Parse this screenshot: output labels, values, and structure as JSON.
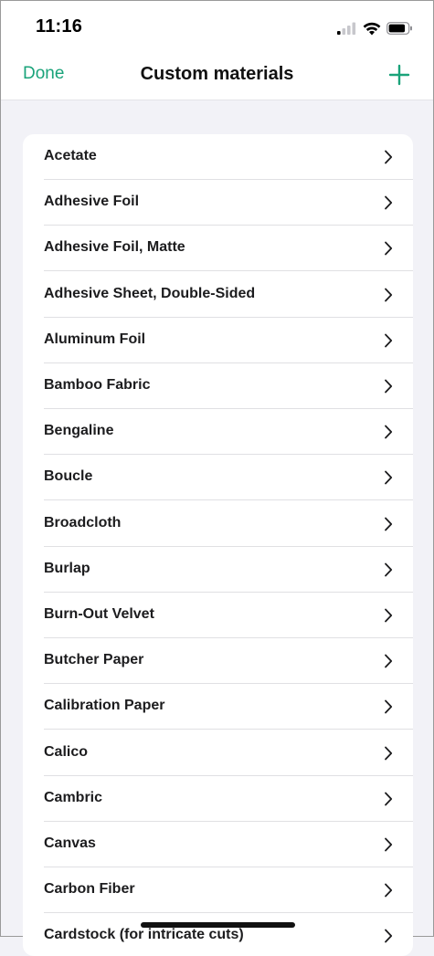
{
  "status_bar": {
    "time": "11:16"
  },
  "nav": {
    "done_label": "Done",
    "title": "Custom materials",
    "add_icon": "plus-icon"
  },
  "colors": {
    "accent": "#1aa37a",
    "background": "#f2f2f7",
    "card": "#ffffff"
  },
  "materials": [
    "Acetate",
    "Adhesive Foil",
    "Adhesive Foil, Matte",
    "Adhesive Sheet, Double-Sided",
    "Aluminum Foil",
    "Bamboo Fabric",
    "Bengaline",
    "Boucle",
    "Broadcloth",
    "Burlap",
    "Burn-Out Velvet",
    "Butcher Paper",
    "Calibration Paper",
    "Calico",
    "Cambric",
    "Canvas",
    "Carbon Fiber",
    "Cardstock (for intricate cuts)"
  ]
}
